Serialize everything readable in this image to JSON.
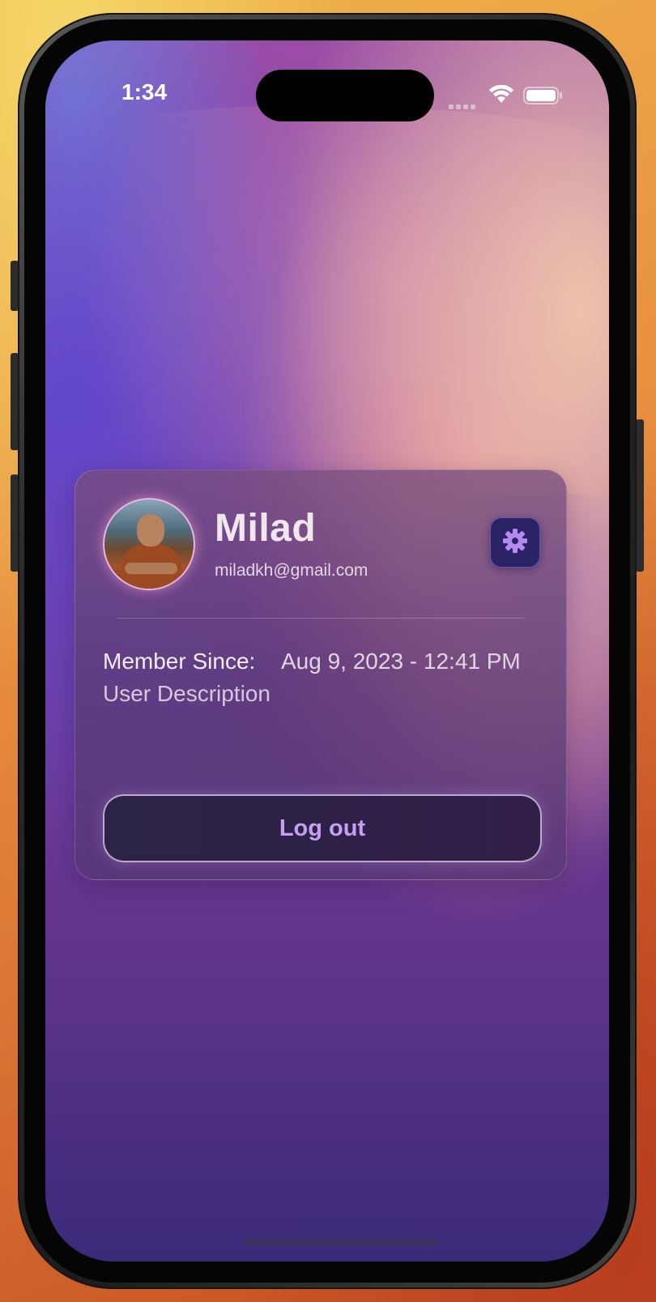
{
  "status_bar": {
    "time": "1:34"
  },
  "profile": {
    "name": "Milad",
    "email": "miladkh@gmail.com",
    "member_since_label": "Member Since:",
    "member_since_value": "Aug 9, 2023 - 12:41 PM",
    "description": "User Description"
  },
  "actions": {
    "logout_label": "Log out"
  },
  "icons": {
    "settings": "gear-icon",
    "wifi": "wifi-icon",
    "battery": "battery-icon",
    "signal": "signal-icon"
  },
  "colors": {
    "accent": "#c69ef2",
    "settings_bg": "#2a2466"
  }
}
